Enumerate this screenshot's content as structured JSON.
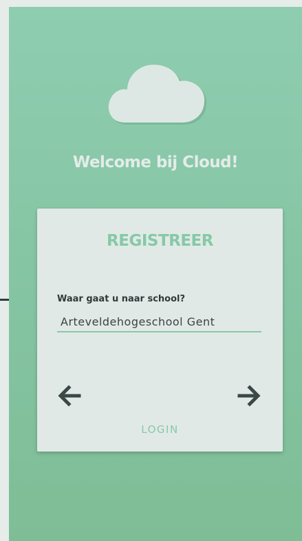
{
  "header": {
    "welcome_text": "Welcome bij Cloud!"
  },
  "logo": {
    "icon": "cloud-icon"
  },
  "form": {
    "title": "REGISTREER",
    "school_label": "Waar gaat u naar school?",
    "school_value": "Arteveldehogeschool Gent"
  },
  "navigation": {
    "back_icon": "arrow-left-icon",
    "next_icon": "arrow-right-icon",
    "login_label": "LOGIN"
  },
  "colors": {
    "accent": "#86c9a6",
    "background": "#87c6a5",
    "card": "#e1e9e7",
    "text_dark": "#2f3a38"
  }
}
